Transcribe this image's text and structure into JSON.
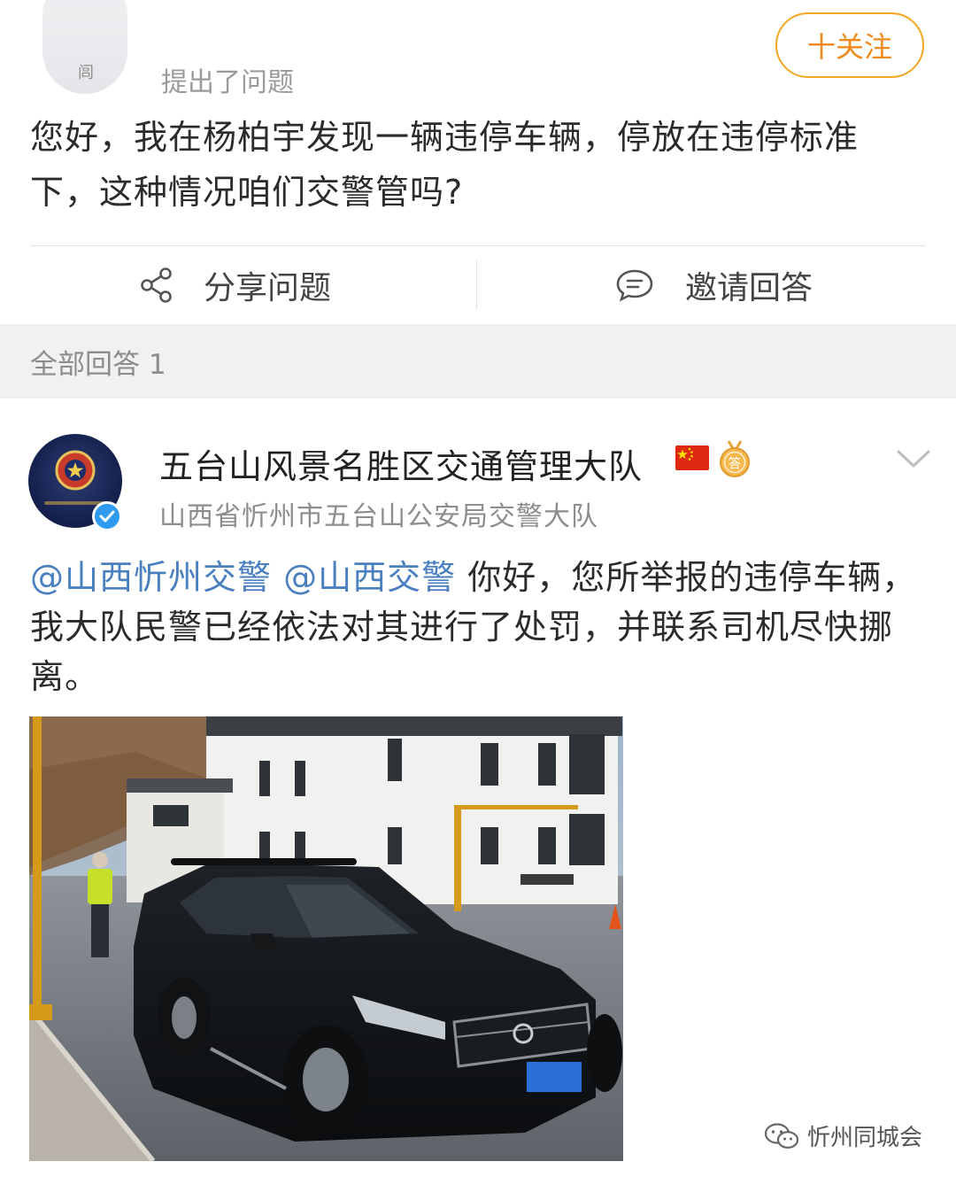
{
  "question": {
    "asker_action": "提出了问题",
    "follow_button": "十关注",
    "text": "您好，我在杨柏宇发现一辆违停车辆，停放在违停标准下，这种情况咱们交警管吗?"
  },
  "actions": {
    "share_label": "分享问题",
    "invite_label": "邀请回答"
  },
  "answers_section": {
    "label": "全部回答 1"
  },
  "answer": {
    "author_name": "五台山风景名胜区交通管理大队",
    "author_org": "山西省忻州市五台山公安局交警大队",
    "mention_1": "@山西忻州交警",
    "mention_2": "@山西交警",
    "body": " 你好，您所举报的违停车辆，我大队民警已经依法对其进行了处罚，并联系司机尽快挪离。"
  },
  "icons": {
    "share": "share-icon",
    "invite": "comment-icon",
    "flag": "china-flag-icon",
    "medal": "answer-medal-icon",
    "verified": "verified-icon",
    "more": "chevron-down-icon"
  },
  "colors": {
    "follow_accent": "#f5a623",
    "mention": "#4a7fc0",
    "verified": "#2e9bf0",
    "section_band": "#f1f1f1"
  },
  "watermark": {
    "text": "忻州同城会"
  }
}
